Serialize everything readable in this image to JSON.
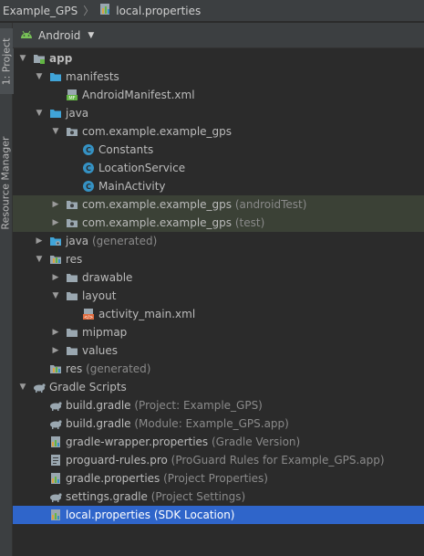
{
  "breadcrumb": {
    "project": "Example_GPS",
    "file": "local.properties"
  },
  "sidebar": {
    "project_tab": "1: Project",
    "resource_tab": "Resource Manager"
  },
  "panel": {
    "view": "Android"
  },
  "tree": [
    {
      "label": "app",
      "indent": 0,
      "arrow": "down",
      "icon": "module-folder-icon",
      "bold": true
    },
    {
      "label": "manifests",
      "indent": 1,
      "arrow": "down",
      "icon": "folder-blue-icon"
    },
    {
      "label": "AndroidManifest.xml",
      "indent": 2,
      "icon": "manifest-file-icon"
    },
    {
      "label": "java",
      "indent": 1,
      "arrow": "down",
      "icon": "folder-blue-icon"
    },
    {
      "label": "com.example.example_gps",
      "indent": 2,
      "arrow": "down",
      "icon": "package-icon"
    },
    {
      "label": "Constants",
      "indent": 3,
      "icon": "class-icon"
    },
    {
      "label": "LocationService",
      "indent": 3,
      "icon": "class-icon"
    },
    {
      "label": "MainActivity",
      "indent": 3,
      "icon": "class-icon"
    },
    {
      "label": "com.example.example_gps",
      "hint": "(androidTest)",
      "indent": 2,
      "arrow": "right",
      "icon": "package-icon",
      "test": true
    },
    {
      "label": "com.example.example_gps",
      "hint": "(test)",
      "indent": 2,
      "arrow": "right",
      "icon": "package-icon",
      "test": true
    },
    {
      "label": "java",
      "hint": "(generated)",
      "indent": 1,
      "arrow": "right",
      "icon": "generated-folder-icon"
    },
    {
      "label": "res",
      "indent": 1,
      "arrow": "down",
      "icon": "res-folder-icon"
    },
    {
      "label": "drawable",
      "indent": 2,
      "arrow": "right",
      "icon": "folder-icon"
    },
    {
      "label": "layout",
      "indent": 2,
      "arrow": "down",
      "icon": "folder-icon"
    },
    {
      "label": "activity_main.xml",
      "indent": 3,
      "icon": "layout-file-icon"
    },
    {
      "label": "mipmap",
      "indent": 2,
      "arrow": "right",
      "icon": "folder-icon"
    },
    {
      "label": "values",
      "indent": 2,
      "arrow": "right",
      "icon": "folder-icon"
    },
    {
      "label": "res",
      "hint": "(generated)",
      "indent": 1,
      "icon": "res-folder-icon"
    },
    {
      "label": "Gradle Scripts",
      "indent": 0,
      "arrow": "down",
      "icon": "gradle-icon"
    },
    {
      "label": "build.gradle",
      "hint": "(Project: Example_GPS)",
      "indent": 1,
      "icon": "gradle-icon"
    },
    {
      "label": "build.gradle",
      "hint": "(Module: Example_GPS.app)",
      "indent": 1,
      "icon": "gradle-icon"
    },
    {
      "label": "gradle-wrapper.properties",
      "hint": "(Gradle Version)",
      "indent": 1,
      "icon": "properties-icon"
    },
    {
      "label": "proguard-rules.pro",
      "hint": "(ProGuard Rules for Example_GPS.app)",
      "indent": 1,
      "icon": "text-file-icon"
    },
    {
      "label": "gradle.properties",
      "hint": "(Project Properties)",
      "indent": 1,
      "icon": "properties-icon"
    },
    {
      "label": "settings.gradle",
      "hint": "(Project Settings)",
      "indent": 1,
      "icon": "gradle-icon"
    },
    {
      "label": "local.properties",
      "hint": "(SDK Location)",
      "indent": 1,
      "icon": "properties-icon",
      "selected": true
    }
  ],
  "colors": {
    "selection": "#2f65ca",
    "test_row": "#3b4136",
    "class_icon": "#3592c4"
  }
}
